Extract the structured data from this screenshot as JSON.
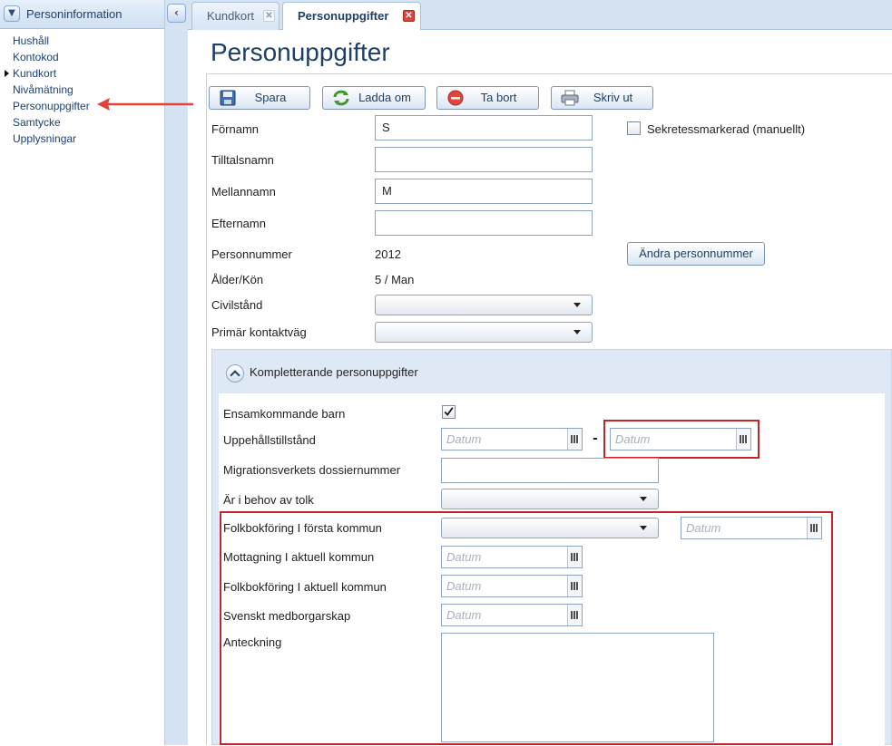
{
  "left_panel": {
    "title": "Personinformation",
    "items": [
      {
        "label": "Hushåll",
        "active": false
      },
      {
        "label": "Kontokod",
        "active": false
      },
      {
        "label": "Kundkort",
        "active": true
      },
      {
        "label": "Nivåmätning",
        "active": false
      },
      {
        "label": "Personuppgifter",
        "active": false
      },
      {
        "label": "Samtycke",
        "active": false
      },
      {
        "label": "Upplysningar",
        "active": false
      }
    ]
  },
  "tabs": [
    {
      "label": "Kundkort",
      "active": false,
      "close": "✕"
    },
    {
      "label": "Personuppgifter",
      "active": true,
      "close": "✕"
    }
  ],
  "page": {
    "title": "Personuppgifter"
  },
  "toolbar": {
    "save": "Spara",
    "reload": "Ladda om",
    "delete": "Ta bort",
    "print": "Skriv ut"
  },
  "form": {
    "firstname_label": "Förnamn",
    "firstname_value": "S",
    "callname_label": "Tilltalsnamn",
    "callname_value": "",
    "middlename_label": "Mellannamn",
    "middlename_value": "M",
    "lastname_label": "Efternamn",
    "lastname_value": "",
    "confidential_label": "Sekretessmarkerad (manuellt)",
    "confidential_checked": false,
    "personnummer_label": "Personnummer",
    "personnummer_value": "2012",
    "change_personnummer": "Ändra personnummer",
    "age_gender_label": "Ålder/Kön",
    "age_gender_value": "5 / Man",
    "civil_label": "Civilstånd",
    "civil_value": "",
    "contact_label": "Primär kontaktväg",
    "contact_value": ""
  },
  "section": {
    "title": "Kompletterande personuppgifter",
    "unaccompanied_label": "Ensamkommande barn",
    "unaccompanied_checked": true,
    "residence_label": "Uppehållstillstånd",
    "date_placeholder": "Datum",
    "date_separator": "-",
    "dossier_label": "Migrationsverkets dossiernummer",
    "dossier_value": "",
    "interpreter_label": "Är i behov av tolk",
    "interpreter_value": "",
    "reg_first_label": "Folkbokföring I första kommun",
    "reg_first_value": "",
    "reception_label": "Mottagning I aktuell kommun",
    "reg_current_label": "Folkbokföring I aktuell kommun",
    "citizenship_label": "Svenskt medborgarskap",
    "note_label": "Anteckning",
    "note_value": ""
  },
  "colors": {
    "accent": "#1f3f68",
    "annotation": "#c4232b",
    "arrow": "#e0433a"
  }
}
